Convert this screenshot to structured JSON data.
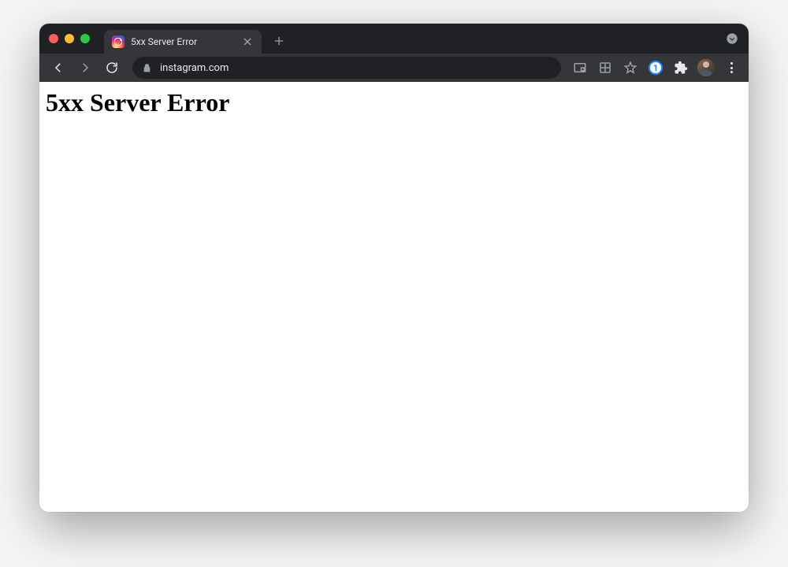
{
  "tab": {
    "title": "5xx Server Error"
  },
  "addressBar": {
    "url": "instagram.com"
  },
  "page": {
    "heading": "5xx Server Error"
  },
  "extensions": {
    "onepassword_label": "1"
  }
}
